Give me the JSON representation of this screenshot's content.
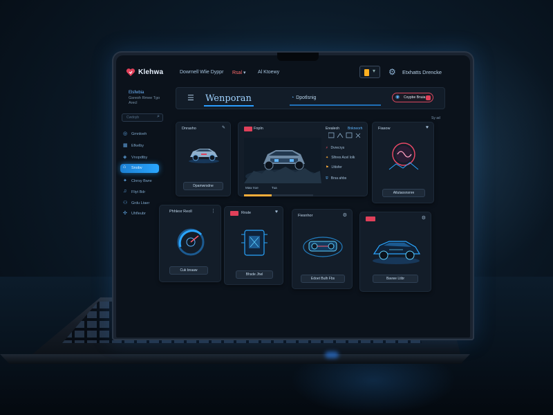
{
  "app": {
    "logo_text": "Klehwa",
    "links": [
      "Dowrnell Wlie Dyppr",
      "Rsal",
      "Al Ktoewy"
    ],
    "user_label": "Etxhatts Drencke"
  },
  "sidebar": {
    "brand": "Elsfwbia",
    "sub1": "Gsreoh Rmee Tgo",
    "sub2": "Arecl",
    "search_placeholder": "Cwdoyb",
    "items": [
      {
        "label": "Gmnloeh",
        "icon": "gamepad-icon"
      },
      {
        "label": "Efkelby",
        "icon": "grid-icon"
      },
      {
        "label": "Vnopdtby",
        "icon": "chart-icon"
      },
      {
        "label": "Snobv",
        "icon": "home-icon"
      },
      {
        "label": "Clnrsy Bwre",
        "icon": "star-icon"
      },
      {
        "label": "Fliyt Bdr",
        "icon": "bell-icon"
      },
      {
        "label": "Grdu Ltaer",
        "icon": "user-icon"
      },
      {
        "label": "Uhfleubr",
        "icon": "cog-icon"
      }
    ]
  },
  "header": {
    "title": "Wenporan",
    "tab": "Dpotlsnig",
    "pill": "Coypbe Bnuia",
    "aside": "Sy ad"
  },
  "cards": {
    "car": {
      "title": "Dnrasho",
      "button": "Dpamwrsdne"
    },
    "hero": {
      "title": "Fnpln",
      "side_title": "Erealeoh",
      "side_title2": "Bnkneorh",
      "list": [
        "Dvrecrys",
        "Slhres Acel Iolk",
        "Lfdsfer",
        "Brsa ahbs"
      ],
      "foot1": "Maw Xoe",
      "foot2": "Tua",
      "progress_pct": 40
    },
    "neon": {
      "title": "Fiasow",
      "button": "Atlutaosnsnre"
    },
    "gauge": {
      "title": "Phhlexr Reoll",
      "button": "Cuk bnaaw"
    },
    "chip": {
      "title": "Rnsle",
      "button": "Bhsde Jhel"
    },
    "engine": {
      "title": "Fiesnhor",
      "button": "Edoet Bulh Fbs"
    },
    "vehicle": {
      "title": "",
      "button": "Bavwe Ltibr"
    }
  },
  "colors": {
    "accent": "#2a9dff",
    "danger": "#e0405a",
    "warning": "#ffae3a",
    "background": "#0b121b"
  }
}
